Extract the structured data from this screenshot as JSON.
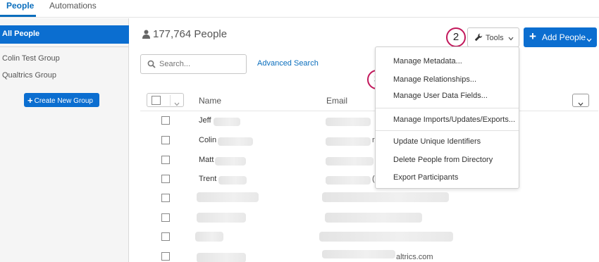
{
  "tabs": [
    {
      "label": "People",
      "active": true
    },
    {
      "label": "Automations",
      "active": false
    }
  ],
  "sidebar": {
    "active_item": "All People",
    "groups": [
      "Colin Test Group",
      "Qualtrics Group"
    ],
    "create_button": "Create New Group"
  },
  "header": {
    "people_count": "177,764 People",
    "tools_label": "Tools",
    "add_people_label": "Add People",
    "step_badges": [
      "2",
      "3"
    ]
  },
  "search": {
    "placeholder": "Search...",
    "advanced_link": "Advanced Search"
  },
  "table": {
    "columns": [
      "Name",
      "Email"
    ],
    "rows": [
      {
        "name": "Jeff",
        "email": ""
      },
      {
        "name": "Colin",
        "email": "r"
      },
      {
        "name": "Matt",
        "email": ""
      },
      {
        "name": "Trent",
        "email": "("
      },
      {
        "name": "",
        "email": ""
      },
      {
        "name": "",
        "email": ""
      },
      {
        "name": "",
        "email": ""
      },
      {
        "name": "",
        "email": "altrics.com"
      }
    ]
  },
  "tools_menu": {
    "items": [
      "Manage Metadata...",
      "Manage Relationships...",
      "Manage User Data Fields...",
      "Manage Imports/Updates/Exports...",
      "Update Unique Identifiers",
      "Delete People from Directory",
      "Export Participants"
    ]
  },
  "colors": {
    "accent": "#0b6ed0",
    "badge_ring": "#c2185b"
  }
}
